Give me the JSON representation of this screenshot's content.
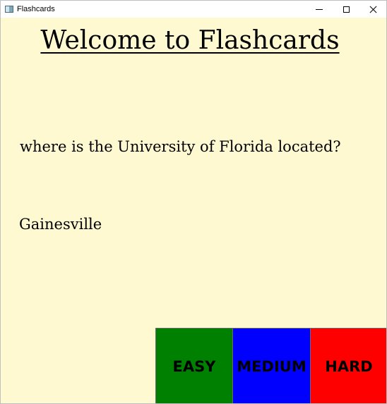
{
  "window": {
    "title": "Flashcards",
    "icon": "app-window-icon",
    "background_color": "#fff9d1"
  },
  "main": {
    "heading": "Welcome to Flashcards",
    "question": "where is the University of Florida located?",
    "answer": "Gainesville"
  },
  "buttons": {
    "easy": {
      "label": "EASY",
      "color": "#008000"
    },
    "medium": {
      "label": "MEDIUM",
      "color": "#0000ff"
    },
    "hard": {
      "label": "HARD",
      "color": "#ff0000"
    }
  }
}
